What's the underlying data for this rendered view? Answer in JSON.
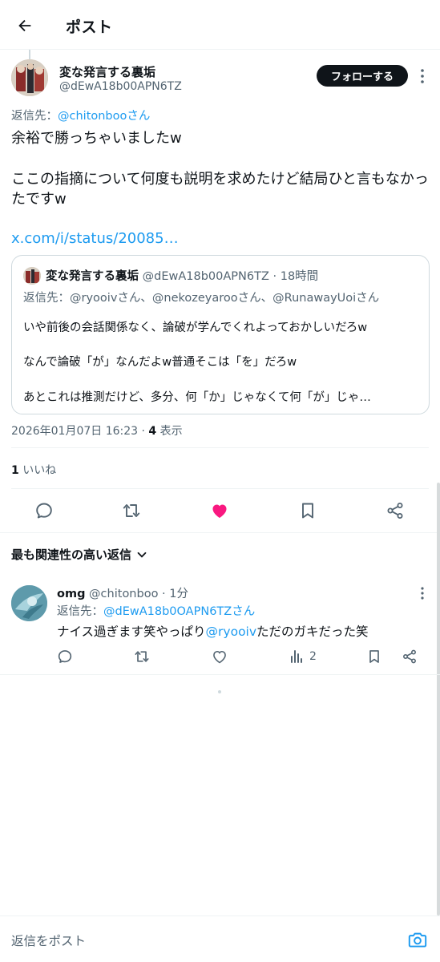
{
  "header": {
    "title": "ポスト"
  },
  "post": {
    "author_name": "変な発言する裏垢",
    "author_handle": "@dEwA18b00APN6TZ",
    "follow_label": "フォローする",
    "reply_to_prefix": "返信先：",
    "reply_to_user": "@chitonboo",
    "reply_to_suffix": "さん",
    "body_line1": "余裕で勝っちゃいましたw",
    "body_line2": "ここの指摘について何度も説明を求めたけど結局ひと言もなかったですw",
    "link_text": "x.com/i/status/20085…",
    "timestamp": "2026年01月07日 16:23 · ",
    "views_count": "4",
    "views_label": " 表示",
    "likes_count": "1",
    "likes_label": " いいね"
  },
  "quote": {
    "author_name": "変な発言する裏垢",
    "author_handle": " @dEwA18b00APN6TZ",
    "time": " · 18時間",
    "reply_to_prefix": "返信先：",
    "reply_to_users": "@ryooivさん、@nekozeyarooさん、@RunawayUoiさん",
    "line1": "いや前後の会話関係なく、論破が学んでくれよっておかしいだろw",
    "line2": "なんで論破「が」なんだよw普通そこは「を」だろw",
    "line3": "あとこれは推測だけど、多分、何「か」じゃなくて何「が」じゃ…"
  },
  "replies_section": {
    "sort_label": "最も関連性の高い返信"
  },
  "reply": {
    "author_name": "omg",
    "author_handle": " @chitonboo",
    "time": " · 1分",
    "reply_to_prefix": "返信先：",
    "reply_to_user": "@dEwA18b0OAPN6TZさん",
    "text_before": "ナイス過ぎます笑やっぱり",
    "text_mention": "@ryooiv",
    "text_after": "ただのガキだった笑",
    "views_count": "2"
  },
  "composer": {
    "placeholder": "返信をポスト"
  },
  "colors": {
    "accent": "#1d9bf0",
    "like_active": "#f91880",
    "text_secondary": "#536471",
    "follow_bg": "#0f1419"
  },
  "icons": [
    "back-arrow-icon",
    "more-icon",
    "reply-icon",
    "repost-icon",
    "heart-icon",
    "bookmark-icon",
    "share-icon",
    "chevron-down-icon",
    "views-icon",
    "camera-icon"
  ]
}
